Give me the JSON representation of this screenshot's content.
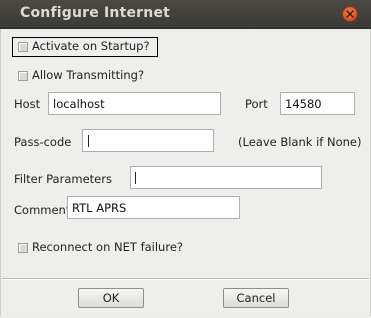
{
  "window": {
    "title": "Configure Internet",
    "close_icon": "close-icon"
  },
  "options": {
    "activate_on_startup": {
      "label": "Activate on Startup?",
      "checked": false
    },
    "allow_transmitting": {
      "label": "Allow Transmitting?",
      "checked": false
    },
    "reconnect_on_failure": {
      "label": "Reconnect on NET failure?",
      "checked": false
    }
  },
  "host": {
    "label": "Host",
    "value": "localhost"
  },
  "port": {
    "label": "Port",
    "value": "14580"
  },
  "passcode": {
    "label": "Pass-code",
    "value": "",
    "hint": "(Leave Blank if None)"
  },
  "filter": {
    "label": "Filter Parameters",
    "value": ""
  },
  "comment": {
    "label": "Comment:",
    "value": "RTL APRS"
  },
  "buttons": {
    "ok": "OK",
    "cancel": "Cancel"
  }
}
